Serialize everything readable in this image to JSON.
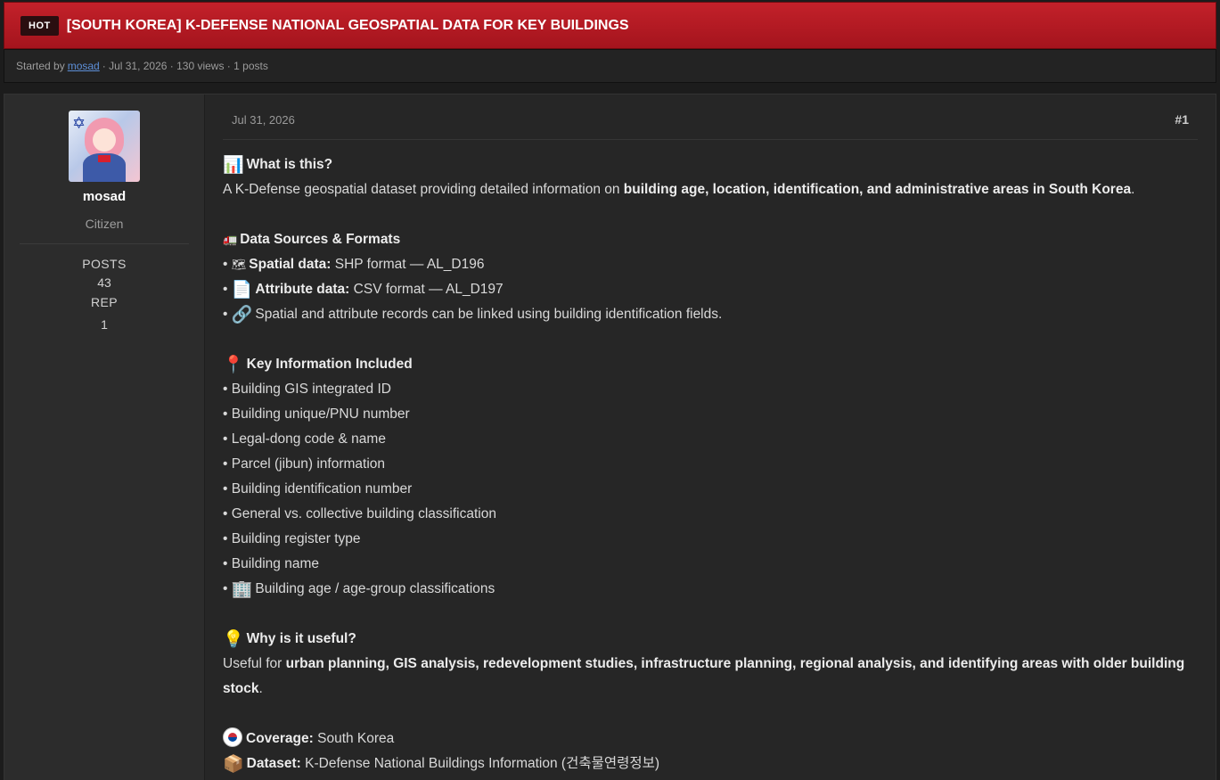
{
  "thread": {
    "badge": "HOT",
    "title": "[SOUTH KOREA] K-DEFENSE NATIONAL GEOSPATIAL DATA FOR KEY BUILDINGS",
    "started_by_label": "Started by",
    "author": "mosad",
    "meta_rest": "· Jul 31, 2026 · 130 views · 1 posts"
  },
  "user": {
    "name": "mosad",
    "rank": "Citizen",
    "posts_label": "POSTS",
    "posts": "43",
    "rep_label": "REP",
    "rep": "1"
  },
  "post": {
    "date": "Jul 31, 2026",
    "number": "#1",
    "what_heading": "What is this?",
    "what_pre": "A K-Defense geospatial dataset providing detailed information on ",
    "what_bold": "building age, location, identification, and administrative areas in South Korea",
    "what_post": ".",
    "sources_heading": "Data Sources & Formats",
    "sources": [
      {
        "label": "Spatial data:",
        "text": "SHP format — AL_D196"
      },
      {
        "label": "Attribute data:",
        "text": "CSV format — AL_D197"
      },
      {
        "text": "Spatial and attribute records can be linked using building identification fields."
      }
    ],
    "key_heading": "Key Information Included",
    "key_items": [
      "Building GIS integrated ID",
      "Building unique/PNU number",
      "Legal-dong code & name",
      "Parcel (jibun) information",
      "Building identification number",
      "General vs. collective building classification",
      "Building register type",
      "Building name",
      "Building age / age-group classifications"
    ],
    "why_heading": "Why is it useful?",
    "why_pre": "Useful for ",
    "why_bold": "urban planning, GIS analysis, redevelopment studies, infrastructure planning, regional analysis, and identifying areas with older building stock",
    "why_post": ".",
    "coverage_label": "Coverage:",
    "coverage": "South Korea",
    "dataset_label": "Dataset:",
    "dataset": "K-Defense National Buildings Information (건축물연령정보)"
  },
  "icons": {
    "chart": "📊",
    "truck": "🚛",
    "map": "🗺",
    "document": "📄",
    "link": "🔗",
    "pin": "📍",
    "building": "🏢",
    "bulb": "💡",
    "package": "📦",
    "bullet": "•"
  },
  "colors": {
    "title_bar": "#b91b24",
    "hot_badge": "#2a0e10",
    "author_link": "#5d8fd8",
    "background": "#1c1c1c",
    "post_bg": "#262626",
    "sidebar_bg": "#2c2c2c"
  }
}
